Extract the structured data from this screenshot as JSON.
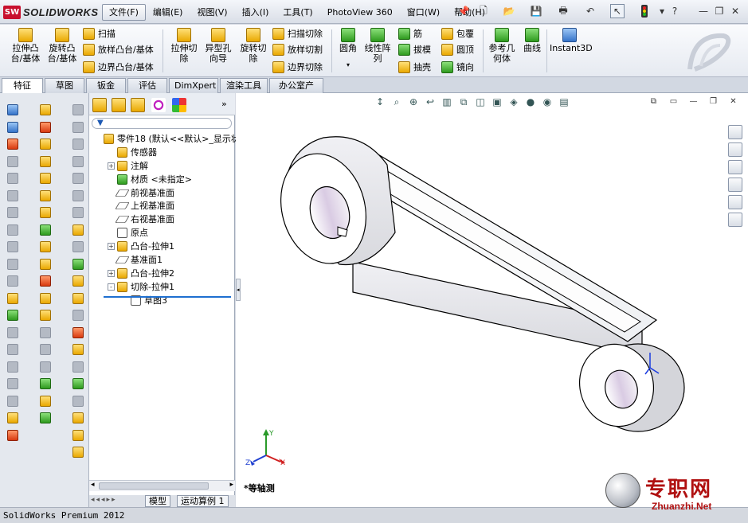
{
  "app": {
    "brand": "SOLIDWORKS",
    "brand_badge": "SW"
  },
  "menu": [
    "文件(F)",
    "编辑(E)",
    "视图(V)",
    "插入(I)",
    "工具(T)",
    "PhotoView 360",
    "窗口(W)",
    "帮助(H)"
  ],
  "commands": {
    "extrude_boss": "拉伸凸\n台/基体",
    "revolve_boss": "旋转凸\n台/基体",
    "sweep": "扫描",
    "loft_boss": "放样凸台/基体",
    "boundary_boss": "边界凸台/基体",
    "extrude_cut": "拉伸切\n除",
    "hole_wizard": "异型孔\n向导",
    "revolve_cut": "旋转切\n除",
    "sweep_cut": "扫描切除",
    "loft_cut": "放样切割",
    "boundary_cut": "边界切除",
    "fillet": "圆角",
    "linear_pattern": "线性阵\n列",
    "rib": "筋",
    "draft": "拔模",
    "shell": "抽壳",
    "wrap": "包覆",
    "dome": "圆顶",
    "mirror": "镜向",
    "ref_geometry": "参考几\n何体",
    "curves": "曲线",
    "instant3d": "Instant3D"
  },
  "tabs": [
    "特征",
    "草图",
    "钣金",
    "评估",
    "DimXpert",
    "渲染工具",
    "办公室产品"
  ],
  "tree": [
    {
      "label": "零件18  (默认<<默认>_显示状态",
      "indent": 0,
      "expand": "",
      "icon": "part"
    },
    {
      "label": "传感器",
      "indent": 1,
      "expand": "",
      "icon": "sensor"
    },
    {
      "label": "注解",
      "indent": 1,
      "expand": "+",
      "icon": "annot"
    },
    {
      "label": "材质 <未指定>",
      "indent": 1,
      "expand": "",
      "icon": "material"
    },
    {
      "label": "前视基准面",
      "indent": 1,
      "expand": "",
      "icon": "plane"
    },
    {
      "label": "上视基准面",
      "indent": 1,
      "expand": "",
      "icon": "plane"
    },
    {
      "label": "右视基准面",
      "indent": 1,
      "expand": "",
      "icon": "plane"
    },
    {
      "label": "原点",
      "indent": 1,
      "expand": "",
      "icon": "origin"
    },
    {
      "label": "凸台-拉伸1",
      "indent": 1,
      "expand": "+",
      "icon": "boss"
    },
    {
      "label": "基准面1",
      "indent": 1,
      "expand": "",
      "icon": "plane"
    },
    {
      "label": "凸台-拉伸2",
      "indent": 1,
      "expand": "+",
      "icon": "boss"
    },
    {
      "label": "切除-拉伸1",
      "indent": 1,
      "expand": "-",
      "icon": "cut"
    },
    {
      "label": "草图3",
      "indent": 2,
      "expand": "",
      "icon": "sketch"
    }
  ],
  "bottom_tabs": [
    "模型",
    "运动算例 1"
  ],
  "view_name": "*等轴测",
  "status": "SolidWorks Premium 2012",
  "watermark": {
    "cn": "专职网",
    "en": "Zhuanzhi.Net"
  },
  "triad": {
    "x": "X",
    "y": "Y",
    "z": "Z"
  }
}
